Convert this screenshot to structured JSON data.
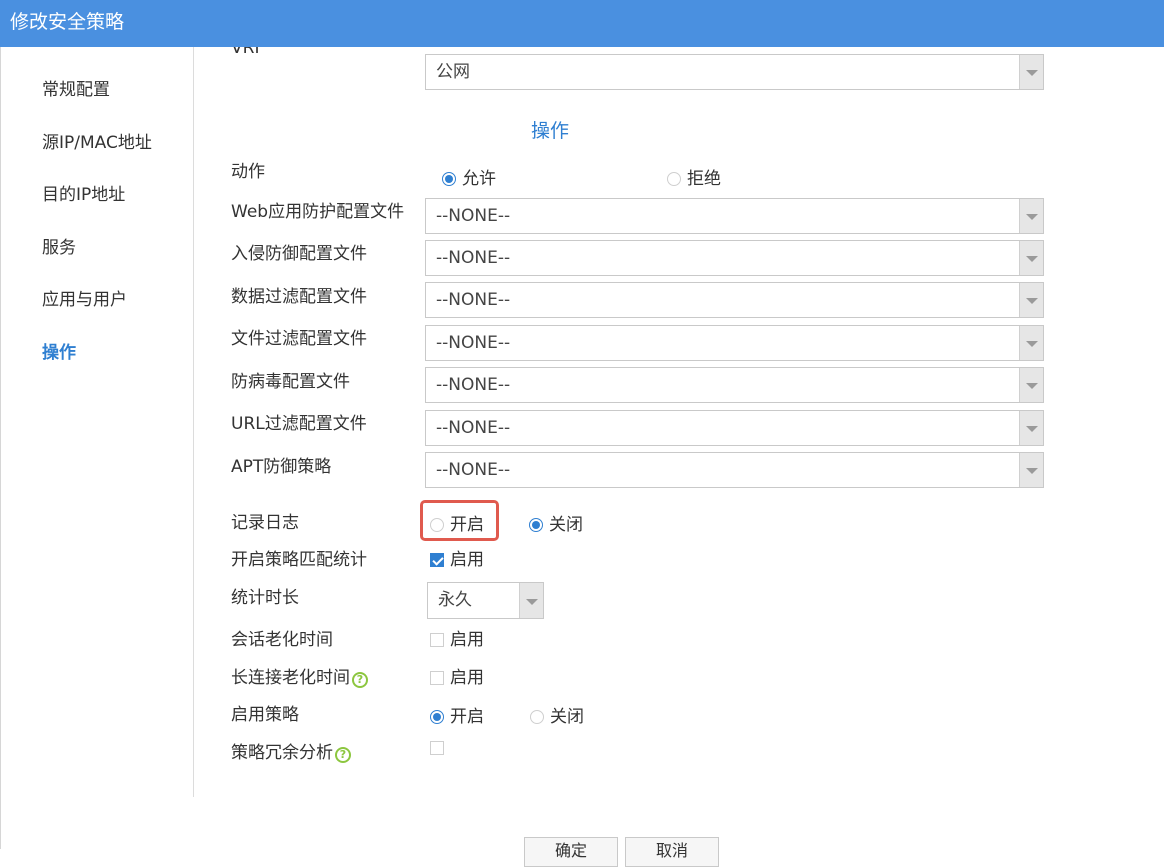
{
  "window": {
    "title": "修改安全策略"
  },
  "sidebar": {
    "items": [
      {
        "label": "常规配置",
        "active": false
      },
      {
        "label": "源IP/MAC地址",
        "active": false
      },
      {
        "label": "目的IP地址",
        "active": false
      },
      {
        "label": "服务",
        "active": false
      },
      {
        "label": "应用与用户",
        "active": false
      },
      {
        "label": "操作",
        "active": true
      }
    ]
  },
  "form": {
    "vrf": {
      "label": "VRF",
      "value": "公网"
    },
    "section_title": "操作",
    "action": {
      "label": "动作",
      "options": [
        "允许",
        "拒绝"
      ],
      "selected": "允许"
    },
    "profiles": [
      {
        "label": "Web应用防护配置文件",
        "value": "--NONE--"
      },
      {
        "label": "入侵防御配置文件",
        "value": "--NONE--"
      },
      {
        "label": "数据过滤配置文件",
        "value": "--NONE--"
      },
      {
        "label": "文件过滤配置文件",
        "value": "--NONE--"
      },
      {
        "label": "防病毒配置文件",
        "value": "--NONE--"
      },
      {
        "label": "URL过滤配置文件",
        "value": "--NONE--"
      },
      {
        "label": "APT防御策略",
        "value": "--NONE--"
      }
    ],
    "logging": {
      "label": "记录日志",
      "on_label": "开启",
      "off_label": "关闭",
      "selected": "关闭"
    },
    "match_stats": {
      "label": "开启策略匹配统计",
      "check_label": "启用",
      "checked": true
    },
    "stats_duration": {
      "label": "统计时长",
      "value": "永久"
    },
    "session_aging": {
      "label": "会话老化时间",
      "check_label": "启用",
      "checked": false
    },
    "long_conn_aging": {
      "label": "长连接老化时间",
      "check_label": "启用",
      "checked": false
    },
    "enable_policy": {
      "label": "启用策略",
      "on_label": "开启",
      "off_label": "关闭",
      "selected": "开启"
    },
    "redundancy": {
      "label": "策略冗余分析",
      "checked": false
    },
    "help_glyph": "?"
  },
  "footer": {
    "ok_label": "确定",
    "cancel_label": "取消"
  },
  "colors": {
    "accent": "#2f7fd1",
    "titlebar": "#4a90e0",
    "highlight": "#e05a4e",
    "help": "#8cc63f"
  }
}
